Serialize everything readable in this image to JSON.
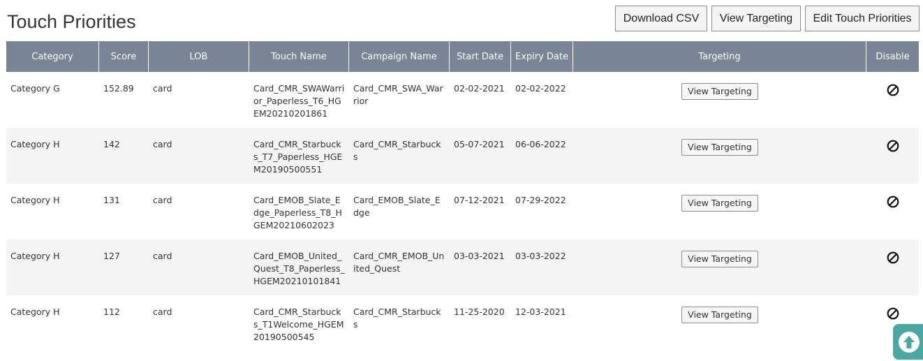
{
  "page": {
    "title": "Touch Priorities"
  },
  "toolbar": {
    "download_label": "Download CSV",
    "view_targeting_label": "View Targeting",
    "edit_label": "Edit Touch Priorities"
  },
  "table": {
    "headers": {
      "category": "Category",
      "score": "Score",
      "lob": "LOB",
      "touch_name": "Touch Name",
      "campaign_name": "Campaign Name",
      "start_date": "Start Date",
      "expiry_date": "Expiry Date",
      "targeting": "Targeting",
      "disable": "Disable"
    },
    "rows": [
      {
        "category": "Category G",
        "score": "152.89",
        "lob": "card",
        "touch_name": "Card_CMR_SWAWarrior_Paperless_T6_HGEM20210201861",
        "campaign_name": "Card_CMR_SWA_Warrior",
        "start_date": "02-02-2021",
        "expiry_date": "02-02-2022",
        "targeting_label": "View Targeting"
      },
      {
        "category": "Category H",
        "score": "142",
        "lob": "card",
        "touch_name": "Card_CMR_Starbucks_T7_Paperless_HGEM20190500551",
        "campaign_name": "Card_CMR_Starbucks",
        "start_date": "05-07-2021",
        "expiry_date": "06-06-2022",
        "targeting_label": "View Targeting"
      },
      {
        "category": "Category H",
        "score": "131",
        "lob": "card",
        "touch_name": "Card_EMOB_Slate_Edge_Paperless_T8_HGEM20210602023",
        "campaign_name": "Card_EMOB_Slate_Edge",
        "start_date": "07-12-2021",
        "expiry_date": "07-29-2022",
        "targeting_label": "View Targeting"
      },
      {
        "category": "Category H",
        "score": "127",
        "lob": "card",
        "touch_name": "Card_EMOB_United_Quest_T8_Paperless_HGEM20210101841",
        "campaign_name": "Card_CMR_EMOB_United_Quest",
        "start_date": "03-03-2021",
        "expiry_date": "03-03-2022",
        "targeting_label": "View Targeting"
      },
      {
        "category": "Category H",
        "score": "112",
        "lob": "card",
        "touch_name": "Card_CMR_Starbucks_T1Welcome_HGEM20190500545",
        "campaign_name": "Card_CMR_Starbucks",
        "start_date": "11-25-2020",
        "expiry_date": "12-03-2021",
        "targeting_label": "View Targeting"
      }
    ]
  },
  "icons": {
    "disable": "disable-icon",
    "scroll_top": "arrow-up-circle-icon"
  },
  "colors": {
    "header_bg": "#798597",
    "alt_row_bg": "#f4f4f4",
    "scroll_button": "#4aa8a3"
  }
}
